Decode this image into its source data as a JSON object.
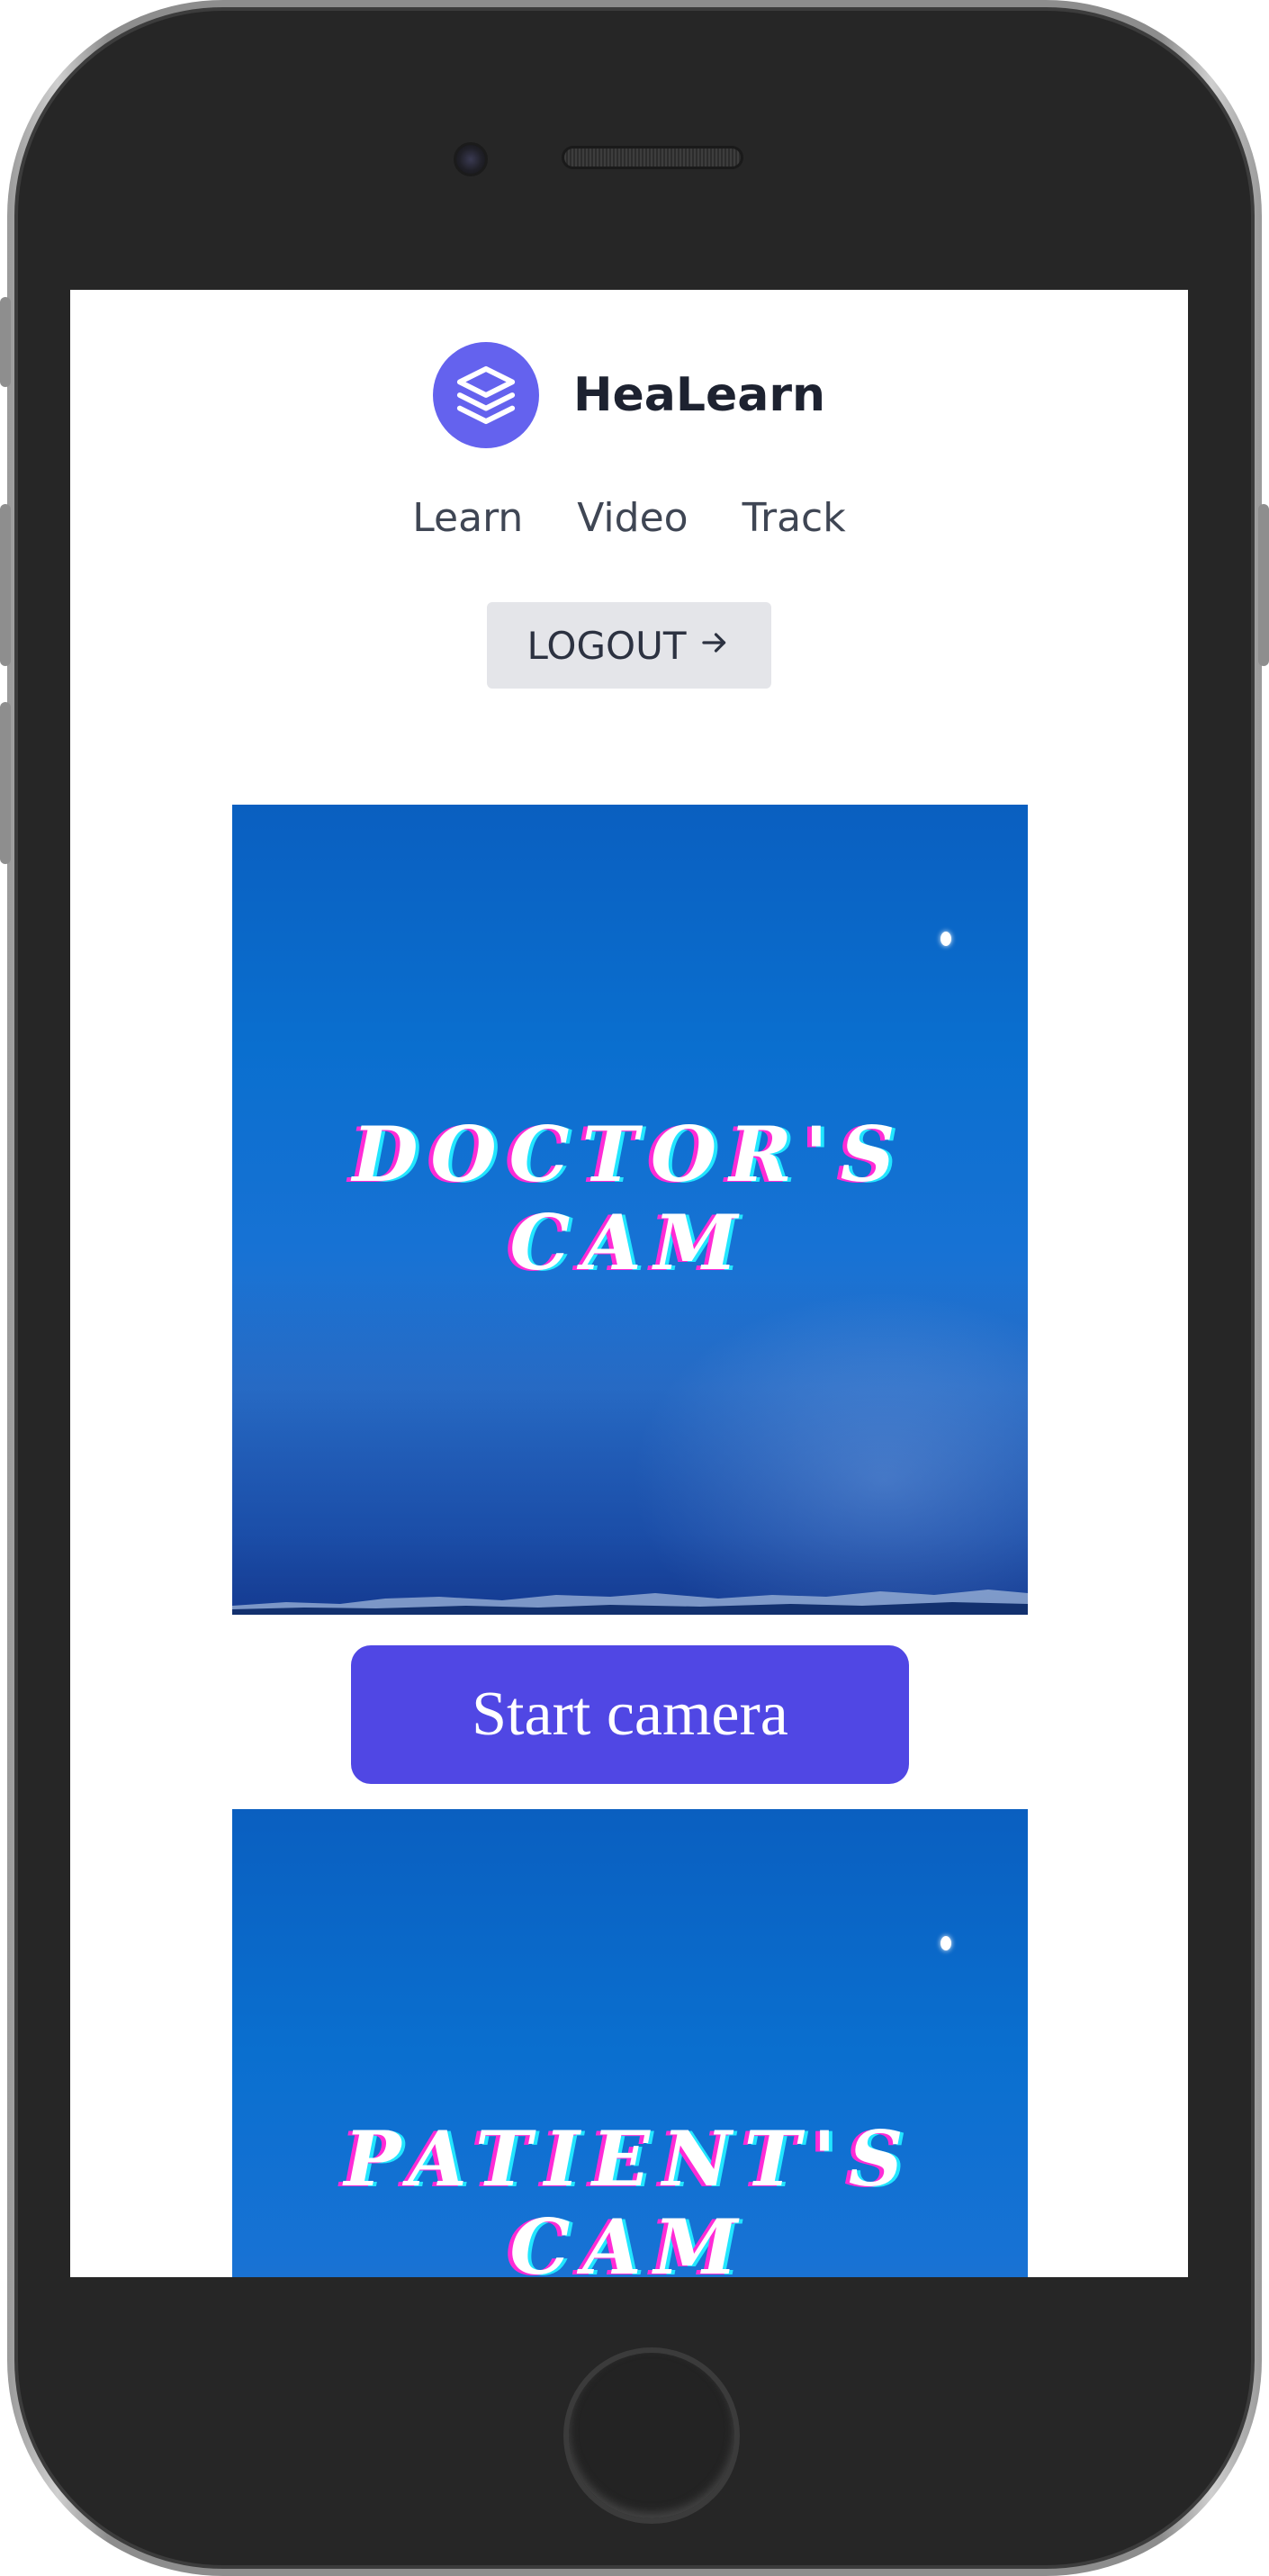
{
  "app": {
    "name": "HeaLearn",
    "logo_icon": "layers-icon",
    "brand_color": "#6462ee"
  },
  "nav": {
    "items": [
      {
        "label": "Learn"
      },
      {
        "label": "Video"
      },
      {
        "label": "Track"
      }
    ]
  },
  "logout": {
    "label": "LOGOUT",
    "icon": "arrow-right-icon"
  },
  "doctor_cam": {
    "title_line1": "DOCTOR'S",
    "title_line2": "CAM"
  },
  "start_camera": {
    "label": "Start camera",
    "color": "#5047e4"
  },
  "patient_cam": {
    "title_line1": "PATIENT'S",
    "title_line2": "CAM"
  }
}
